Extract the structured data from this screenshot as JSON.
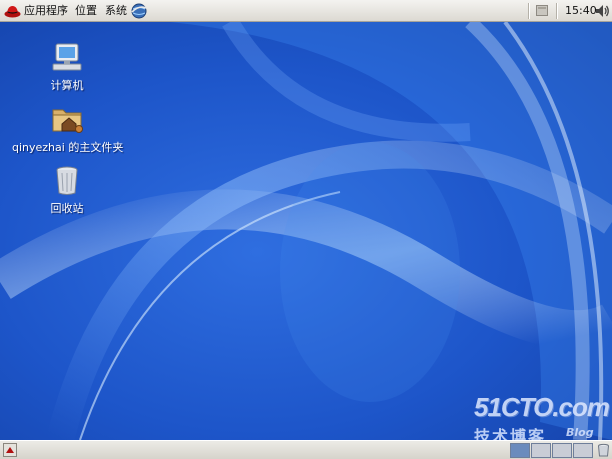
{
  "top_panel": {
    "menus": [
      {
        "label": "应用程序"
      },
      {
        "label": "位置"
      },
      {
        "label": "系统"
      }
    ],
    "clock": "15:40",
    "icons": [
      "redhat-icon",
      "browser-icon",
      "notification-icon",
      "volume-icon"
    ]
  },
  "desktop": {
    "icons": [
      {
        "label": "计算机",
        "icon": "computer-icon"
      },
      {
        "label": "qinyezhai 的主文件夹",
        "icon": "home-folder-icon"
      },
      {
        "label": "回收站",
        "icon": "trash-icon"
      }
    ],
    "watermark": {
      "logo": "51CTO.com",
      "subtitle": "技术博客",
      "blog": "Blog"
    }
  },
  "bottom_panel": {
    "workspaces": [
      {
        "active": true
      },
      {
        "active": false
      },
      {
        "active": false
      },
      {
        "active": false
      }
    ]
  },
  "colors": {
    "desktop_blue": "#1a4fc4",
    "panel_gray": "#dcd9d2"
  }
}
